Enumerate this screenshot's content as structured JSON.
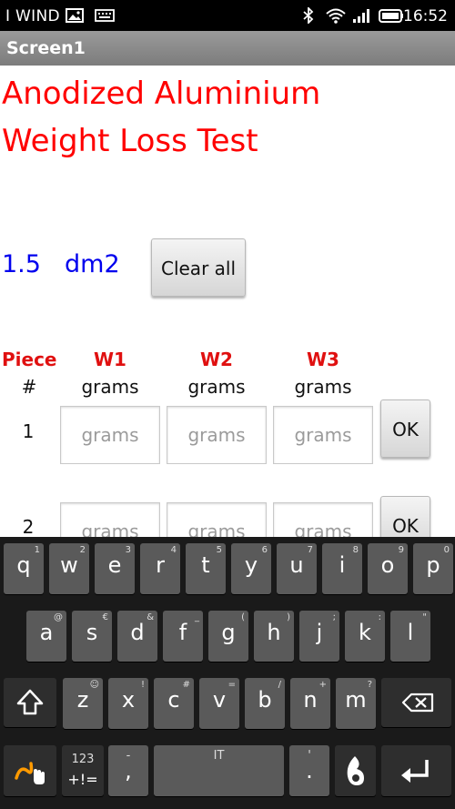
{
  "statusbar": {
    "carrier": "I WIND",
    "time": "16:52"
  },
  "titlebar": {
    "title": "Screen1"
  },
  "app": {
    "heading_line1": "Anodized Aluminium",
    "heading_line2": "Weight Loss Test",
    "area_value": "1.5",
    "area_unit": "dm2",
    "clear_label": "Clear all",
    "col_piece": "Piece",
    "col_piece_sub": "#",
    "col_w1": "W1",
    "col_w2": "W2",
    "col_w3": "W3",
    "unit_label": "grams",
    "rows": [
      {
        "num": "1",
        "placeholder": "grams",
        "ok": "OK"
      },
      {
        "num": "2",
        "placeholder": "grams",
        "ok": "OK"
      }
    ]
  },
  "keyboard": {
    "row1": [
      {
        "k": "q",
        "h": "1"
      },
      {
        "k": "w",
        "h": "2"
      },
      {
        "k": "e",
        "h": "3"
      },
      {
        "k": "r",
        "h": "4"
      },
      {
        "k": "t",
        "h": "5"
      },
      {
        "k": "y",
        "h": "6"
      },
      {
        "k": "u",
        "h": "7"
      },
      {
        "k": "i",
        "h": "8"
      },
      {
        "k": "o",
        "h": "9"
      },
      {
        "k": "p",
        "h": "0"
      }
    ],
    "row2": [
      {
        "k": "a",
        "h": "@"
      },
      {
        "k": "s",
        "h": "€"
      },
      {
        "k": "d",
        "h": "&"
      },
      {
        "k": "f",
        "h": "_"
      },
      {
        "k": "g",
        "h": "("
      },
      {
        "k": "h",
        "h": ")"
      },
      {
        "k": "j",
        "h": ";"
      },
      {
        "k": "k",
        "h": ":"
      },
      {
        "k": "l",
        "h": "\""
      }
    ],
    "row3": [
      {
        "k": "z",
        "h": "☺"
      },
      {
        "k": "x",
        "h": "!"
      },
      {
        "k": "c",
        "h": "#"
      },
      {
        "k": "v",
        "h": "="
      },
      {
        "k": "b",
        "h": "/"
      },
      {
        "k": "n",
        "h": "+"
      },
      {
        "k": "m",
        "h": "?"
      }
    ],
    "sym_top": "123",
    "sym_bottom": "+!=",
    "comma": ",",
    "comma_hint": "-",
    "space_label": "IT",
    "period": ".",
    "period_hint": "'"
  }
}
